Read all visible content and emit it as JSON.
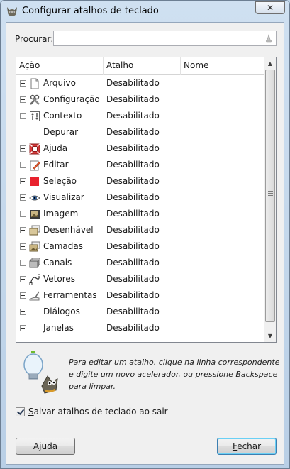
{
  "window": {
    "title": "Configurar atalhos de teclado",
    "icon": "gimp-wilber-icon",
    "close_glyph": "✕"
  },
  "search": {
    "label_accesskey": "P",
    "label_rest": "rocurar:",
    "value": "",
    "placeholder": "",
    "clear_icon": "clear-search-icon"
  },
  "tree": {
    "columns": [
      "Ação",
      "Atalho",
      "Nome"
    ],
    "rows": [
      {
        "label": "Arquivo",
        "shortcut": "Desabilitado",
        "icon": "file-icon",
        "expandable": true
      },
      {
        "label": "Configuração",
        "shortcut": "Desabilitado",
        "icon": "tools-config-icon",
        "expandable": true
      },
      {
        "label": "Contexto",
        "shortcut": "Desabilitado",
        "icon": "context-icon",
        "expandable": true
      },
      {
        "label": "Depurar",
        "shortcut": "Desabilitado",
        "icon": "",
        "expandable": false
      },
      {
        "label": "Ajuda",
        "shortcut": "Desabilitado",
        "icon": "help-lifebuoy-icon",
        "expandable": true
      },
      {
        "label": "Editar",
        "shortcut": "Desabilitado",
        "icon": "edit-icon",
        "expandable": true
      },
      {
        "label": "Seleção",
        "shortcut": "Desabilitado",
        "icon": "selection-icon",
        "expandable": true
      },
      {
        "label": "Visualizar",
        "shortcut": "Desabilitado",
        "icon": "eye-icon",
        "expandable": true
      },
      {
        "label": "Imagem",
        "shortcut": "Desabilitado",
        "icon": "image-icon",
        "expandable": true
      },
      {
        "label": "Desenhável",
        "shortcut": "Desabilitado",
        "icon": "drawable-icon",
        "expandable": true
      },
      {
        "label": "Camadas",
        "shortcut": "Desabilitado",
        "icon": "layers-icon",
        "expandable": true
      },
      {
        "label": "Canais",
        "shortcut": "Desabilitado",
        "icon": "channels-icon",
        "expandable": true
      },
      {
        "label": "Vetores",
        "shortcut": "Desabilitado",
        "icon": "paths-icon",
        "expandable": true
      },
      {
        "label": "Ferramentas",
        "shortcut": "Desabilitado",
        "icon": "tools-icon",
        "expandable": true
      },
      {
        "label": "Diálogos",
        "shortcut": "Desabilitado",
        "icon": "",
        "expandable": true
      },
      {
        "label": "Janelas",
        "shortcut": "Desabilitado",
        "icon": "",
        "expandable": true
      }
    ]
  },
  "hint": {
    "icon": "wilber-lightbulb-icon",
    "text": "Para editar um atalho, clique na linha correspondente e digite um novo acelerador, ou pressione Backspace para limpar."
  },
  "save_on_exit": {
    "checked": true,
    "label_accesskey": "S",
    "label_rest": "alvar atalhos de teclado ao sair"
  },
  "buttons": {
    "help_accesskey": "j",
    "help_pre": "A",
    "help_post": "uda",
    "close_accesskey": "F",
    "close_rest": "echar"
  },
  "colors": {
    "selection_red": "#e8222e",
    "titlebar": "#bfd5ea"
  }
}
